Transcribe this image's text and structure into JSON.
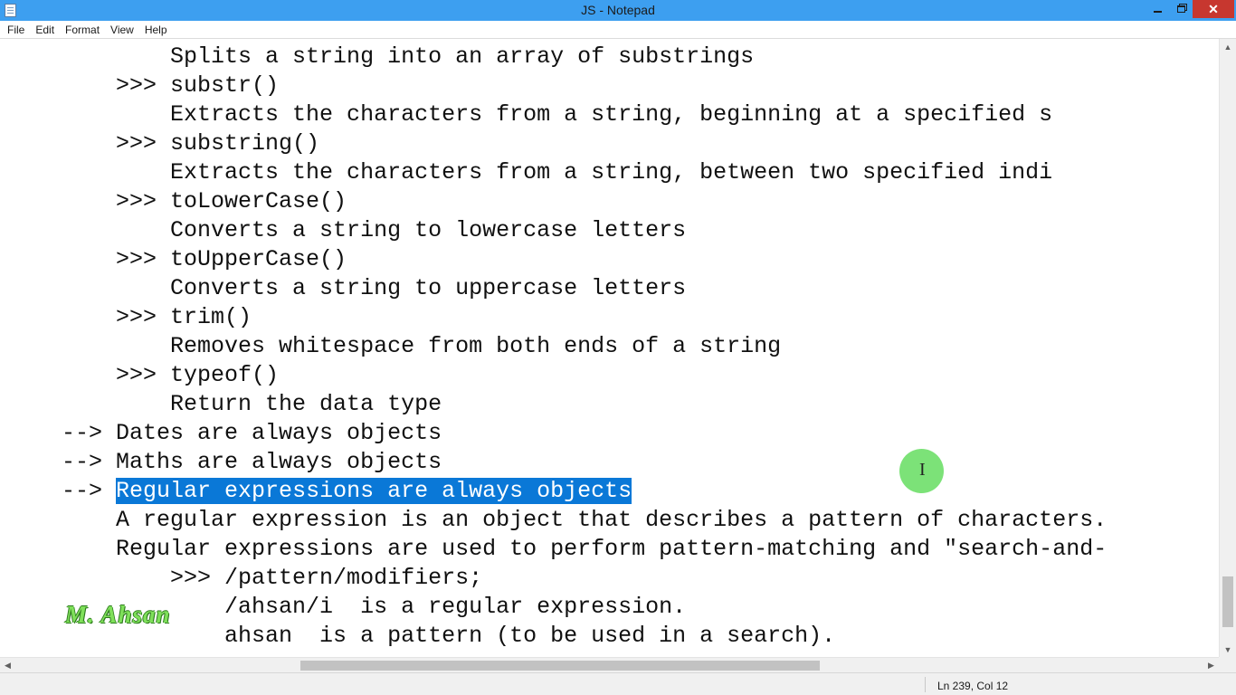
{
  "window": {
    "title": "JS - Notepad",
    "minimize_icon": "minimize-icon",
    "maximize_icon": "restore-icon",
    "close_label": "✕"
  },
  "menu": [
    "File",
    "Edit",
    "Format",
    "View",
    "Help"
  ],
  "editor": {
    "lines": [
      "            Splits a string into an array of substrings",
      "        >>> substr()",
      "            Extracts the characters from a string, beginning at a specified s",
      "        >>> substring()",
      "            Extracts the characters from a string, between two specified indi",
      "        >>> toLowerCase()",
      "            Converts a string to lowercase letters",
      "        >>> toUpperCase()",
      "            Converts a string to uppercase letters",
      "        >>> trim()",
      "            Removes whitespace from both ends of a string",
      "        >>> typeof()",
      "            Return the data type",
      "    --> Dates are always objects",
      "    --> Maths are always objects",
      "    --> ",
      "        A regular expression is an object that describes a pattern of characters.",
      "        Regular expressions are used to perform pattern-matching and \"search-and-",
      "            >>> /pattern/modifiers;",
      "                /ahsan/i  is a regular expression.",
      "                ahsan  is a pattern (to be used in a search)."
    ],
    "selected_text": "Regular expressions are always objects"
  },
  "status": {
    "position": "Ln 239, Col 12"
  },
  "watermark": "M. Ahsan",
  "colors": {
    "titlebar": "#3d9ff0",
    "selection": "#0a78d7",
    "close_button": "#c7372f",
    "cursor_highlight": "#5fdc5a"
  }
}
